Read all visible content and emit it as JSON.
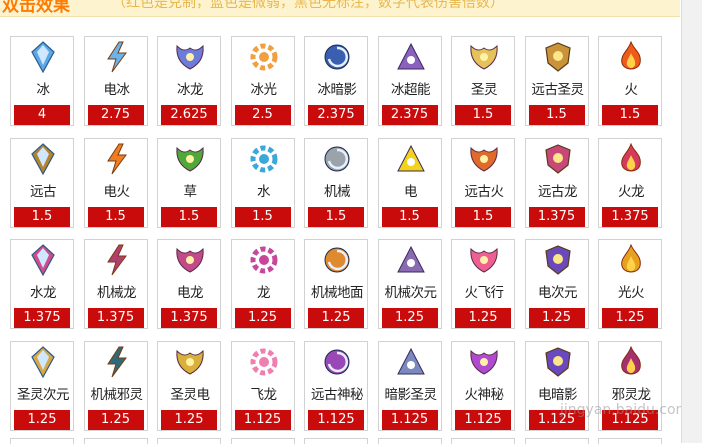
{
  "header": {
    "title": "双击效果",
    "subtitle": "（红色是克制，蓝色是微弱，黑色无标注，数字代表伤害倍数）"
  },
  "colors": {
    "value_bg": "#c90b0b",
    "value_text": "#ffffff",
    "header_bg": "#fdf4cf"
  },
  "watermark": "jingyan.baidu.com",
  "items": [
    {
      "name": "冰",
      "value": "4",
      "icon": "ice-crystal-icon",
      "color": "#5aa8e8"
    },
    {
      "name": "电冰",
      "value": "2.75",
      "icon": "electric-ice-icon",
      "color": "#69b4ea"
    },
    {
      "name": "冰龙",
      "value": "2.625",
      "icon": "ice-dragon-icon",
      "color": "#6b7cd9"
    },
    {
      "name": "冰光",
      "value": "2.5",
      "icon": "ice-light-icon",
      "color": "#f0a040"
    },
    {
      "name": "冰暗影",
      "value": "2.375",
      "icon": "ice-shadow-icon",
      "color": "#3a5fb0"
    },
    {
      "name": "冰超能",
      "value": "2.375",
      "icon": "ice-psychic-icon",
      "color": "#8a60c0"
    },
    {
      "name": "圣灵",
      "value": "1.5",
      "icon": "holy-spirit-icon",
      "color": "#e6c25a"
    },
    {
      "name": "远古圣灵",
      "value": "1.5",
      "icon": "ancient-holy-icon",
      "color": "#c9933a"
    },
    {
      "name": "火",
      "value": "1.5",
      "icon": "fire-icon",
      "color": "#f05a1a"
    },
    {
      "name": "远古",
      "value": "1.5",
      "icon": "ancient-icon",
      "color": "#b5822e"
    },
    {
      "name": "电火",
      "value": "1.5",
      "icon": "electric-fire-icon",
      "color": "#f07d20"
    },
    {
      "name": "草",
      "value": "1.5",
      "icon": "grass-leaf-icon",
      "color": "#4ea83a"
    },
    {
      "name": "水",
      "value": "1.5",
      "icon": "water-drop-icon",
      "color": "#3aa8d8"
    },
    {
      "name": "机械",
      "value": "1.5",
      "icon": "mechanical-wrench-icon",
      "color": "#9aa2aa"
    },
    {
      "name": "电",
      "value": "1.5",
      "icon": "lightning-icon",
      "color": "#f2d21c"
    },
    {
      "name": "远古火",
      "value": "1.5",
      "icon": "ancient-fire-icon",
      "color": "#e06a28"
    },
    {
      "name": "远古龙",
      "value": "1.375",
      "icon": "ancient-dragon-icon",
      "color": "#c8487a"
    },
    {
      "name": "火龙",
      "value": "1.375",
      "icon": "fire-dragon-icon",
      "color": "#d63a5a"
    },
    {
      "name": "水龙",
      "value": "1.375",
      "icon": "water-dragon-icon",
      "color": "#d24c8c"
    },
    {
      "name": "机械龙",
      "value": "1.375",
      "icon": "mech-dragon-icon",
      "color": "#b04070"
    },
    {
      "name": "电龙",
      "value": "1.375",
      "icon": "electric-dragon-icon",
      "color": "#c24a88"
    },
    {
      "name": "龙",
      "value": "1.25",
      "icon": "dragon-icon",
      "color": "#c7479a"
    },
    {
      "name": "机械地面",
      "value": "1.25",
      "icon": "mech-ground-icon",
      "color": "#e08a30"
    },
    {
      "name": "机械次元",
      "value": "1.25",
      "icon": "mech-dimension-icon",
      "color": "#8a6ab0"
    },
    {
      "name": "火飞行",
      "value": "1.25",
      "icon": "fire-flying-icon",
      "color": "#ee6090"
    },
    {
      "name": "电次元",
      "value": "1.25",
      "icon": "electric-dimension-icon",
      "color": "#6a4ab8"
    },
    {
      "name": "光火",
      "value": "1.25",
      "icon": "light-fire-icon",
      "color": "#e8a020"
    },
    {
      "name": "圣灵次元",
      "value": "1.25",
      "icon": "holy-dimension-icon",
      "color": "#d8a848"
    },
    {
      "name": "机械邪灵",
      "value": "1.25",
      "icon": "mech-evil-icon",
      "color": "#2f6a7a"
    },
    {
      "name": "圣灵电",
      "value": "1.25",
      "icon": "holy-electric-icon",
      "color": "#d8b03a"
    },
    {
      "name": "飞龙",
      "value": "1.125",
      "icon": "flying-dragon-icon",
      "color": "#ef7fb0"
    },
    {
      "name": "远古神秘",
      "value": "1.125",
      "icon": "ancient-mystery-icon",
      "color": "#9a48b8"
    },
    {
      "name": "暗影圣灵",
      "value": "1.125",
      "icon": "shadow-holy-icon",
      "color": "#7a8ac0"
    },
    {
      "name": "火神秘",
      "value": "1.125",
      "icon": "fire-mystery-icon",
      "color": "#b04ad0"
    },
    {
      "name": "电暗影",
      "value": "1.125",
      "icon": "electric-shadow-icon",
      "color": "#6a48c0"
    },
    {
      "name": "邪灵龙",
      "value": "1.125",
      "icon": "evil-dragon-icon",
      "color": "#a43070"
    }
  ]
}
